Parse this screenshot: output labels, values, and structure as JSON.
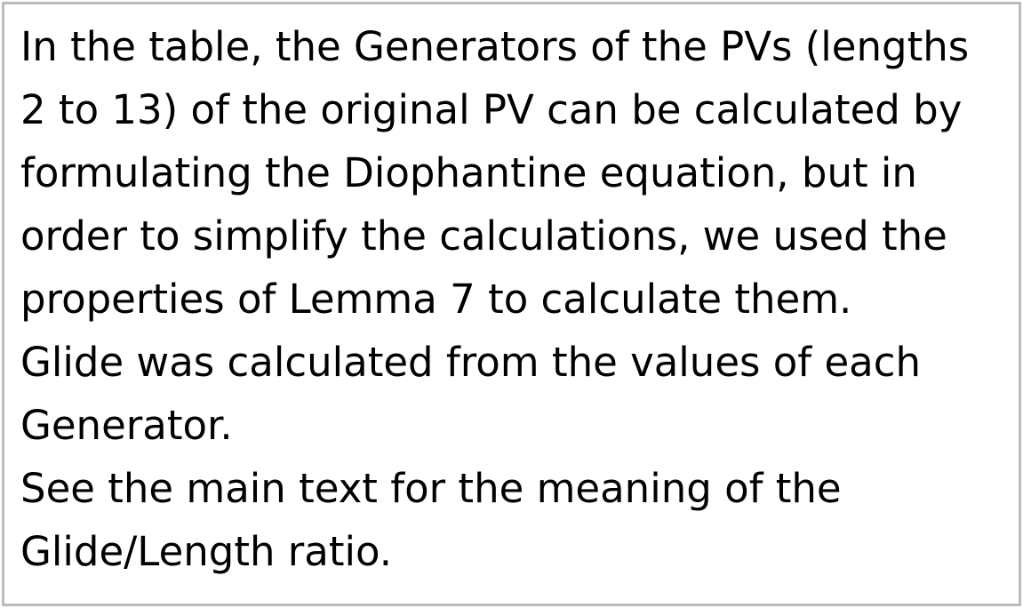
{
  "note": {
    "lines": [
      "In the table, the Generators of the PVs (lengths",
      "2 to 13) of the original PV can be calculated by",
      "formulating the Diophantine equation, but in",
      "order to simplify the calculations, we used the",
      "properties of Lemma 7 to calculate them.",
      "Glide was calculated from the values of each",
      "Generator.",
      "See the main text for the meaning of the",
      "Glide/Length ratio."
    ]
  }
}
